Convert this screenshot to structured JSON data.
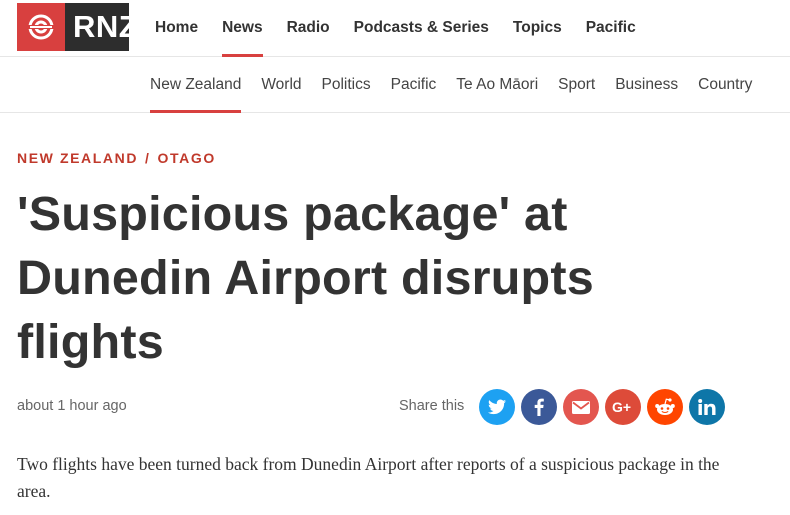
{
  "brand": {
    "name": "RNZ",
    "accent": "#d8403f"
  },
  "main_nav": [
    {
      "label": "Home",
      "active": false
    },
    {
      "label": "News",
      "active": true
    },
    {
      "label": "Radio",
      "active": false
    },
    {
      "label": "Podcasts & Series",
      "active": false
    },
    {
      "label": "Topics",
      "active": false
    },
    {
      "label": "Pacific",
      "active": false
    }
  ],
  "sub_nav": [
    {
      "label": "New Zealand",
      "active": true
    },
    {
      "label": "World",
      "active": false
    },
    {
      "label": "Politics",
      "active": false
    },
    {
      "label": "Pacific",
      "active": false
    },
    {
      "label": "Te Ao Māori",
      "active": false
    },
    {
      "label": "Sport",
      "active": false
    },
    {
      "label": "Business",
      "active": false
    },
    {
      "label": "Country",
      "active": false
    }
  ],
  "article": {
    "breadcrumb": {
      "section": "NEW ZEALAND",
      "separator": "/",
      "region": "OTAGO"
    },
    "headline": "'Suspicious package' at Dunedin Airport disrupts flights",
    "timestamp": "about 1 hour ago",
    "summary": "Two flights have been turned back from Dunedin Airport after reports of a suspicious package in the area."
  },
  "share": {
    "label": "Share this",
    "buttons": [
      {
        "icon": "twitter-icon",
        "color": "#1da1f2"
      },
      {
        "icon": "facebook-icon",
        "color": "#3b5998"
      },
      {
        "icon": "email-icon",
        "color": "#e3564f"
      },
      {
        "icon": "google-plus-icon",
        "color": "#dd4b39"
      },
      {
        "icon": "reddit-icon",
        "color": "#ff4500"
      },
      {
        "icon": "linkedin-icon",
        "color": "#0e76a8"
      }
    ]
  }
}
